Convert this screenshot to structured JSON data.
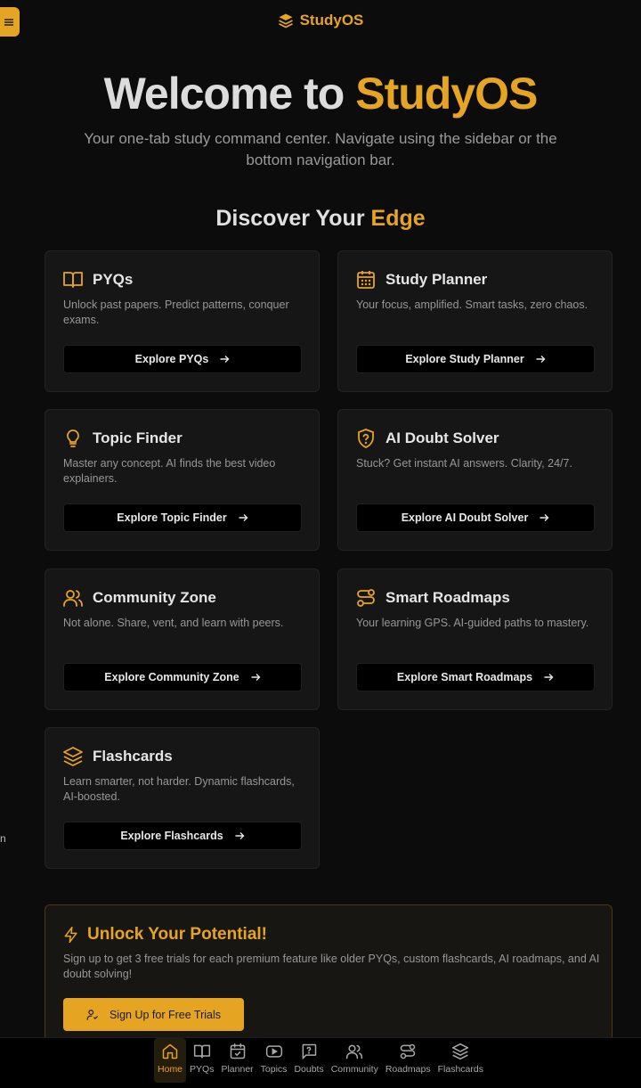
{
  "header": {
    "brand": "StudyOS"
  },
  "hero": {
    "title_prefix": "Welcome to ",
    "title_accent": "StudyOS",
    "subtitle": "Your one-tab study command center. Navigate using the sidebar or the bottom navigation bar."
  },
  "section": {
    "title_prefix": "Discover Your ",
    "title_accent": "Edge"
  },
  "cards": [
    {
      "icon": "book-open-icon",
      "title": "PYQs",
      "desc": "Unlock past papers. Predict patterns, conquer exams.",
      "button": "Explore PYQs"
    },
    {
      "icon": "calendar-icon",
      "title": "Study Planner",
      "desc": "Your focus, amplified. Smart tasks, zero chaos.",
      "button": "Explore Study Planner"
    },
    {
      "icon": "lightbulb-icon",
      "title": "Topic Finder",
      "desc": "Master any concept. AI finds the best video explainers.",
      "button": "Explore Topic Finder"
    },
    {
      "icon": "shield-question-icon",
      "title": "AI Doubt Solver",
      "desc": "Stuck? Get instant AI answers. Clarity, 24/7.",
      "button": "Explore AI Doubt Solver"
    },
    {
      "icon": "users-icon",
      "title": "Community Zone",
      "desc": "Not alone. Share, vent, and learn with peers.",
      "button": "Explore Community Zone"
    },
    {
      "icon": "route-icon",
      "title": "Smart Roadmaps",
      "desc": "Your learning GPS. AI-guided paths to mastery.",
      "button": "Explore Smart Roadmaps"
    },
    {
      "icon": "layers-icon",
      "title": "Flashcards",
      "desc": "Learn smarter, not harder. Dynamic flashcards, AI-boosted.",
      "button": "Explore Flashcards"
    }
  ],
  "promo": {
    "title": "Unlock Your Potential!",
    "desc": "Sign up to get 3 free trials for each premium feature like older PYQs, custom flashcards, AI roadmaps, and AI doubt solving!",
    "button": "Sign Up for Free Trials"
  },
  "stray_text": "n",
  "nav": [
    {
      "label": "Home",
      "icon": "home-icon",
      "active": true
    },
    {
      "label": "PYQs",
      "icon": "book-open-icon",
      "active": false
    },
    {
      "label": "Planner",
      "icon": "calendar-check-icon",
      "active": false
    },
    {
      "label": "Topics",
      "icon": "youtube-icon",
      "active": false
    },
    {
      "label": "Doubts",
      "icon": "message-question-icon",
      "active": false
    },
    {
      "label": "Community",
      "icon": "users-icon",
      "active": false
    },
    {
      "label": "Roadmaps",
      "icon": "route-icon",
      "active": false
    },
    {
      "label": "Flashcards",
      "icon": "layers-icon",
      "active": false
    }
  ],
  "colors": {
    "accent": "#e5a422",
    "background": "#0c0c0c",
    "card": "#161616"
  }
}
